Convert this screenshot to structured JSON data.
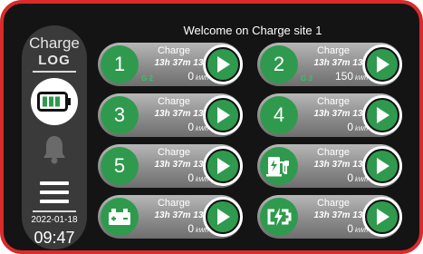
{
  "title": "Welcome on Charge site 1",
  "sidebar": {
    "brand_top": "Charge",
    "brand_logo": "LOG",
    "battery_icon": "battery-charging-icon",
    "bell_icon": "bell-icon",
    "menu_icon": "menu-icon",
    "date": "2022-01-18",
    "time": "09:47"
  },
  "accent_color": "#2f9a4e",
  "frame_color": "#d92b2b",
  "chargers": [
    {
      "id": "1",
      "label": "Charge",
      "duration": "13h 37m 13s",
      "energy": "0",
      "unit": "kWh",
      "gun": "G 2",
      "icon": "number"
    },
    {
      "id": "2",
      "label": "Charge",
      "duration": "13h 37m 13s",
      "energy": "150",
      "unit": "kWh",
      "gun": "G 3",
      "icon": "number"
    },
    {
      "id": "3",
      "label": "Charge",
      "duration": "13h 37m 13s",
      "energy": "0",
      "unit": "kWh",
      "gun": "",
      "icon": "number"
    },
    {
      "id": "4",
      "label": "Charge",
      "duration": "13h 37m 13s",
      "energy": "0",
      "unit": "kWh",
      "gun": "",
      "icon": "number"
    },
    {
      "id": "5",
      "label": "Charge",
      "duration": "13h 37m 13s",
      "energy": "0",
      "unit": "kWh",
      "gun": "",
      "icon": "number"
    },
    {
      "id": "",
      "label": "Charge",
      "duration": "13h 37m 13s",
      "energy": "0",
      "unit": "kWh",
      "gun": "",
      "icon": "ev-station-icon"
    },
    {
      "id": "",
      "label": "Charge",
      "duration": "13h 37m 13s",
      "energy": "0",
      "unit": "kWh",
      "gun": "",
      "icon": "car-battery-icon"
    },
    {
      "id": "",
      "label": "Charge",
      "duration": "13h 37m 13s",
      "energy": "0",
      "unit": "kWh",
      "gun": "",
      "icon": "fast-charge-icon"
    }
  ]
}
